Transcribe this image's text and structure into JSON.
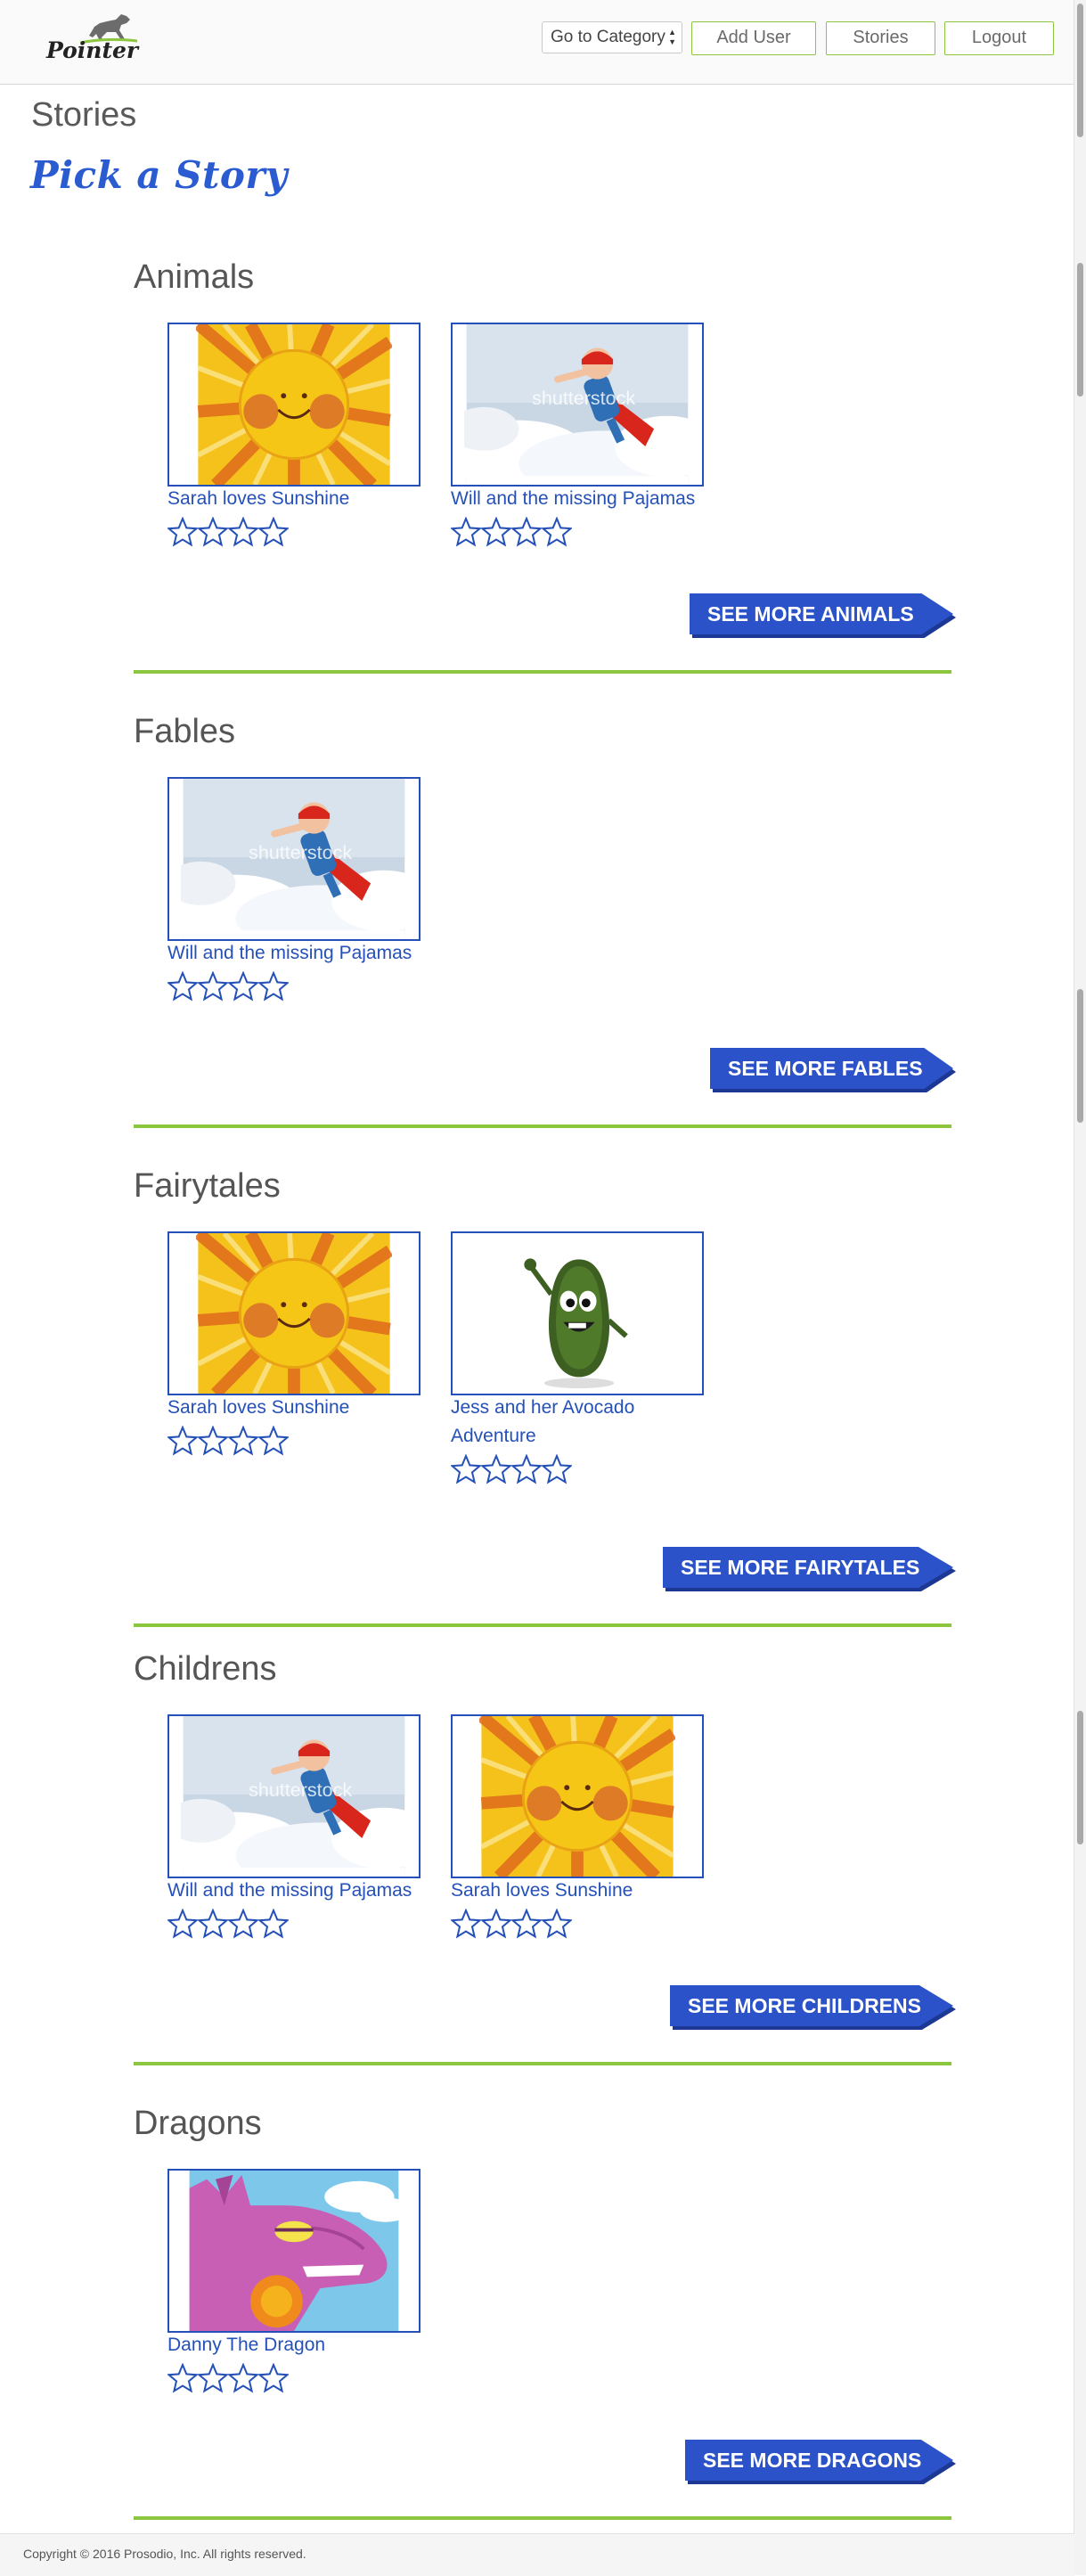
{
  "header": {
    "logo_text": "Pointer",
    "category_select": "Go to Category",
    "nav": [
      {
        "label": "Add User"
      },
      {
        "label": "Stories"
      },
      {
        "label": "Logout"
      }
    ]
  },
  "page": {
    "title": "Stories",
    "subtitle": "Pick a Story"
  },
  "rating_icon": "star-outline-icon",
  "colors": {
    "accent_blue": "#2b52c8",
    "green": "#8cc63f"
  },
  "sections": [
    {
      "title": "Animals",
      "see_more": "SEE MORE ANIMALS",
      "stories": [
        {
          "title": "Sarah loves Sunshine",
          "image": "sunshine"
        },
        {
          "title": "Will and the missing Pajamas",
          "image": "superhero"
        }
      ]
    },
    {
      "title": "Fables",
      "see_more": "SEE MORE FABLES",
      "stories": [
        {
          "title": "Will and the missing Pajamas",
          "image": "superhero"
        }
      ]
    },
    {
      "title": "Fairytales",
      "see_more": "SEE MORE FAIRYTALES",
      "stories": [
        {
          "title": "Sarah loves Sunshine",
          "image": "sunshine"
        },
        {
          "title": "Jess and her Avocado Adventure",
          "image": "avocado"
        }
      ]
    },
    {
      "title": "Childrens",
      "see_more": "SEE MORE CHILDRENS",
      "stories": [
        {
          "title": "Will and the missing Pajamas",
          "image": "superhero"
        },
        {
          "title": "Sarah loves Sunshine",
          "image": "sunshine"
        }
      ]
    },
    {
      "title": "Dragons",
      "see_more": "SEE MORE DRAGONS",
      "stories": [
        {
          "title": "Danny The Dragon",
          "image": "dragon"
        }
      ]
    }
  ],
  "footer": {
    "copyright": "Copyright © 2016 Prosodio, Inc. All rights reserved."
  }
}
